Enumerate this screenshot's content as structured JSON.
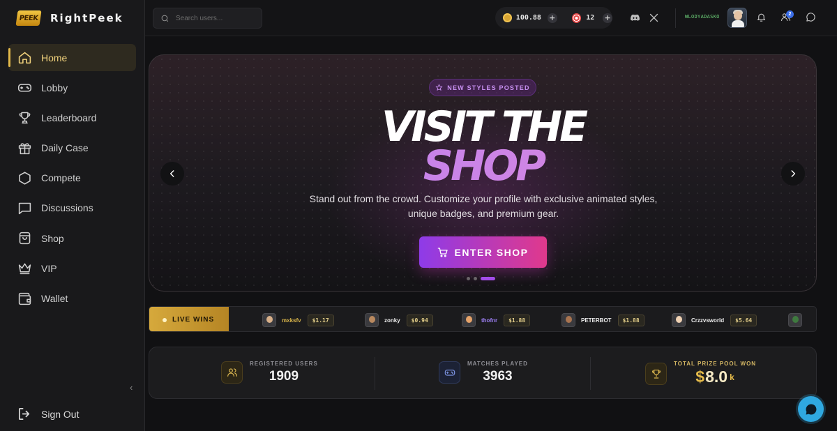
{
  "brand": {
    "logo_text": "PEEK",
    "name": "RightPeek"
  },
  "nav": [
    {
      "label": "Home",
      "icon": "home-icon",
      "active": true
    },
    {
      "label": "Lobby",
      "icon": "gamepad-icon"
    },
    {
      "label": "Leaderboard",
      "icon": "trophy-icon"
    },
    {
      "label": "Daily Case",
      "icon": "gift-icon"
    },
    {
      "label": "Compete",
      "icon": "hexagon-icon"
    },
    {
      "label": "Discussions",
      "icon": "message-icon"
    },
    {
      "label": "Shop",
      "icon": "shopping-bag-icon"
    },
    {
      "label": "VIP",
      "icon": "crown-icon"
    },
    {
      "label": "Wallet",
      "icon": "wallet-icon"
    }
  ],
  "sidebar": {
    "collapse": "‹",
    "signout": "Sign Out"
  },
  "topbar": {
    "search_placeholder": "Search users...",
    "coins": "100.88",
    "tickets": "12",
    "plus": "+",
    "username": "WLODYADASKO",
    "friends_badge": "2"
  },
  "hero": {
    "pill": "NEW STYLES POSTED",
    "title_line1": "VISIT THE",
    "title_line2": "SHOP",
    "subtitle": "Stand out from the crowd. Customize your profile with exclusive animated styles, unique badges, and premium gear.",
    "button": "ENTER SHOP",
    "slides": 3,
    "active_slide": 3
  },
  "live_wins": {
    "label": "LIVE WINS",
    "items": [
      {
        "name": "mxksfv",
        "amount": "$1.17",
        "name_color": "#d8b44a"
      },
      {
        "name": "zonky",
        "amount": "$0.94",
        "name_color": "#eaeaea"
      },
      {
        "name": "thofnr",
        "amount": "$1.88",
        "name_color": "#9a7df0"
      },
      {
        "name": "PETERBOT",
        "amount": "$1.88",
        "name_color": "#eaeaea"
      },
      {
        "name": "Crzzvsworld",
        "amount": "$5.64",
        "name_color": "#eaeaea"
      }
    ]
  },
  "stats": {
    "registered_label": "REGISTERED USERS",
    "registered_value": "1909",
    "matches_label": "MATCHES PLAYED",
    "matches_value": "3963",
    "prize_label": "TOTAL PRIZE POOL WON",
    "prize_symbol": "$",
    "prize_value": "8.0",
    "prize_unit": "k"
  },
  "colors": {
    "accent_gold": "#e2b84a",
    "accent_purple": "#a24ce8",
    "accent_pink": "#e0398c",
    "chat_fab": "#2fa8e0"
  }
}
